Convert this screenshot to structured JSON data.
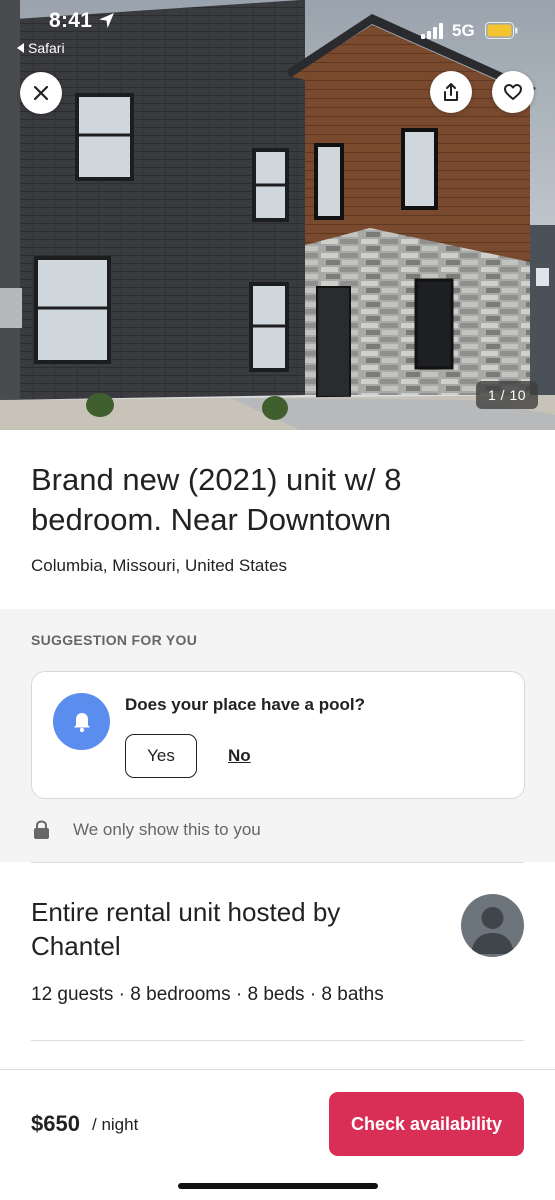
{
  "status_bar": {
    "time": "8:41",
    "back_app": "Safari",
    "network": "5G",
    "battery_color": "#f4c430"
  },
  "photo": {
    "counter": "1 / 10",
    "icons": [
      "close-icon",
      "share-icon",
      "heart-icon"
    ]
  },
  "listing": {
    "title": "Brand new (2021) unit w/ 8 bedroom. Near Downtown",
    "location": "Columbia, Missouri, United States"
  },
  "suggestion": {
    "heading": "SUGGESTION FOR YOU",
    "question": "Does your place have a pool?",
    "yes_label": "Yes",
    "no_label": "No",
    "privacy_note": "We only show this to you",
    "bell_color": "#5b8def"
  },
  "host": {
    "title": "Entire rental unit hosted by Chantel",
    "details": "12 guests · 8 bedrooms · 8 beds · 8 baths"
  },
  "booking": {
    "price": "$650",
    "per": "/ night",
    "cta_label": "Check availability",
    "cta_color": "#d92e56"
  }
}
